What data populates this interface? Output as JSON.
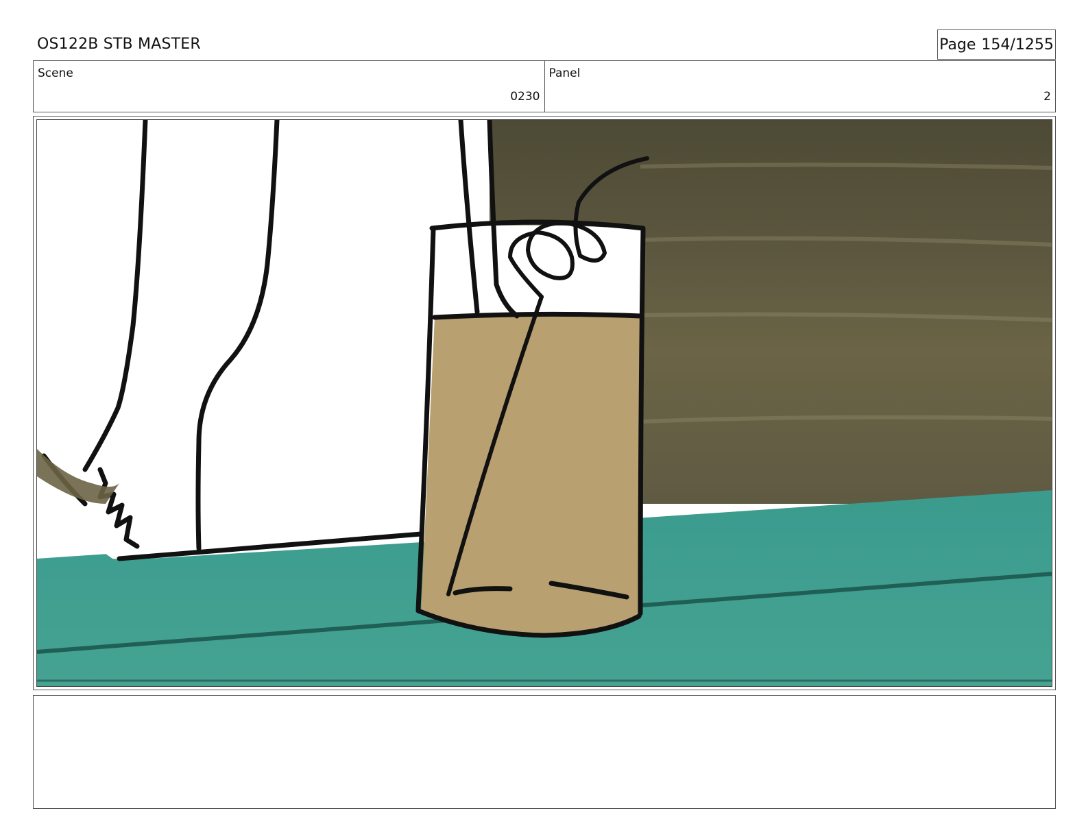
{
  "header": {
    "title": "OS122B STB MASTER",
    "page_label": "Page",
    "page_number": "154/1255"
  },
  "scene": {
    "label": "Scene",
    "value": "0230"
  },
  "panel": {
    "label": "Panel",
    "value": "2"
  },
  "colors": {
    "background_wall": "#5a5540",
    "table_teal": "#3e9a8c",
    "drink_tan": "#b8a070",
    "ink": "#111111"
  }
}
